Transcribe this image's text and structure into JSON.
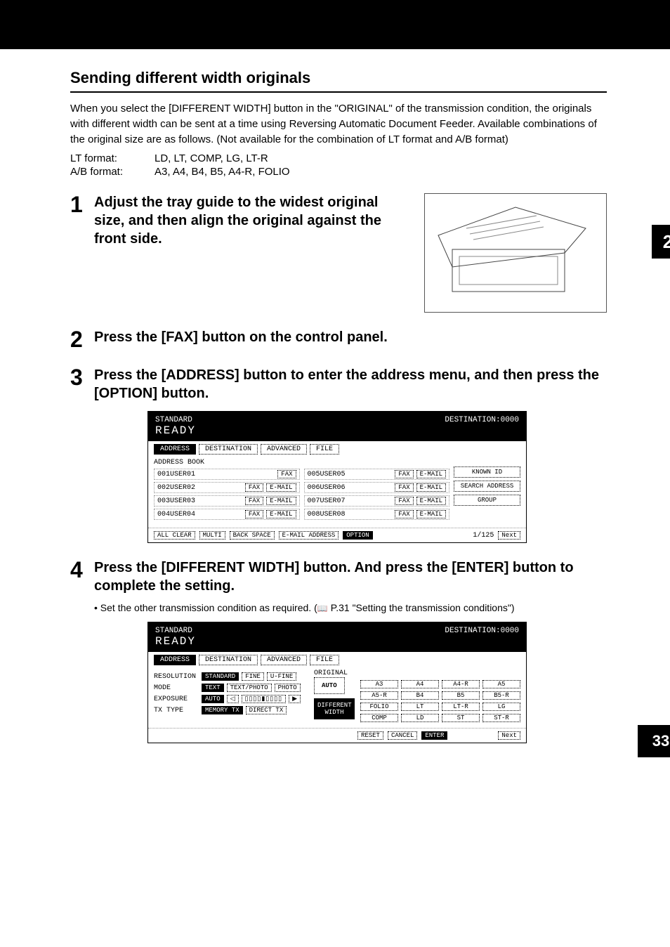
{
  "chapter_tab": "2",
  "page_number": "33",
  "section_title": "Sending different width originals",
  "intro_text": "When you select the [DIFFERENT WIDTH] button in the \"ORIGINAL\" of the transmission condition, the originals with different width can be sent at a time using Reversing Automatic Document Feeder. Available combinations of the original size are as follows. (Not available for the combination of LT format and A/B format)",
  "formats": {
    "lt_label": "LT format:",
    "lt_value": "LD, LT, COMP, LG, LT-R",
    "ab_label": "A/B format:",
    "ab_value": "A3, A4, B4, B5, A4-R, FOLIO"
  },
  "steps": {
    "s1_num": "1",
    "s1_head": "Adjust the tray guide to the widest original size, and then align the original against the front side.",
    "s2_num": "2",
    "s2_head": "Press the [FAX] button on the control panel.",
    "s3_num": "3",
    "s3_head": "Press the [ADDRESS] button to enter the address menu, and then press the [OPTION] button.",
    "s4_num": "4",
    "s4_head": "Press the [DIFFERENT WIDTH] button. And press the [ENTER] button to complete the setting.",
    "s4_bullet": "Set the other transmission condition as required. (",
    "s4_ref": "P.31 \"Setting the transmission conditions\")"
  },
  "screen1": {
    "status": "STANDARD",
    "dest": "DESTINATION:0000",
    "ready": "READY",
    "tabs": {
      "t1": "ADDRESS",
      "t2": "DESTINATION",
      "t3": "ADVANCED",
      "t4": "FILE"
    },
    "book_label": "ADDRESS BOOK",
    "rows_left": [
      "001USER01",
      "002USER02",
      "003USER03",
      "004USER04"
    ],
    "rows_right": [
      "005USER05",
      "006USER06",
      "007USER07",
      "008USER08"
    ],
    "btn_fax": "FAX",
    "btn_email": "E-MAIL",
    "side": {
      "known": "KNOWN ID",
      "search": "SEARCH ADDRESS",
      "group": "GROUP"
    },
    "bottom": {
      "allclear": "ALL CLEAR",
      "multi": "MULTI",
      "backspace": "BACK SPACE",
      "emailaddr": "E-MAIL ADDRESS",
      "option": "OPTION",
      "page": "1/125",
      "next": "Next"
    }
  },
  "screen2": {
    "status": "STANDARD",
    "dest": "DESTINATION:0000",
    "ready": "READY",
    "tabs": {
      "t1": "ADDRESS",
      "t2": "DESTINATION",
      "t3": "ADVANCED",
      "t4": "FILE"
    },
    "labels": {
      "res": "RESOLUTION",
      "mode": "MODE",
      "exp": "EXPOSURE",
      "tx": "TX TYPE",
      "orig": "ORIGINAL"
    },
    "res_opts": {
      "a": "STANDARD",
      "b": "FINE",
      "c": "U-FINE"
    },
    "mode_opts": {
      "a": "TEXT",
      "b": "TEXT/PHOTO",
      "c": "PHOTO"
    },
    "exp_opts": {
      "a": "AUTO"
    },
    "tx_opts": {
      "a": "MEMORY TX",
      "b": "DIRECT TX"
    },
    "orig_opts": {
      "auto": "AUTO",
      "diff": "DIFFERENT WIDTH"
    },
    "sizes": [
      "A3",
      "A4",
      "A4-R",
      "A5",
      "A5-R",
      "B4",
      "B5",
      "B5-R",
      "FOLIO",
      "LT",
      "LT-R",
      "LG",
      "COMP",
      "LD",
      "ST",
      "ST-R"
    ],
    "bottom": {
      "reset": "RESET",
      "cancel": "CANCEL",
      "enter": "ENTER",
      "next": "Next"
    }
  }
}
